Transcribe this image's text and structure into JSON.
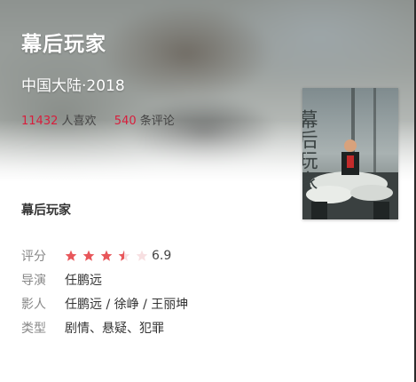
{
  "movie": {
    "title": "幕后玩家",
    "region_year": "中国大陆·2018",
    "likes_count": "11432",
    "likes_label": "人喜欢",
    "comments_count": "540",
    "comments_label": "条评论",
    "poster_title": "幕后玩家",
    "poster_art_text": "幕后玩家"
  },
  "details": {
    "rating_label": "评分",
    "rating_value": "6.9",
    "rating_stars": 3.5,
    "rating_max_stars": 5,
    "director_label": "导演",
    "director": "任鹏远",
    "cast_label": "影人",
    "cast": "任鹏远 / 徐峥 / 王丽坤",
    "genre_label": "类型",
    "genre": "剧情、悬疑、犯罪"
  },
  "colors": {
    "accent": "#d81e3c",
    "star_filled": "#e8565a",
    "star_empty": "#f7dfe1"
  }
}
